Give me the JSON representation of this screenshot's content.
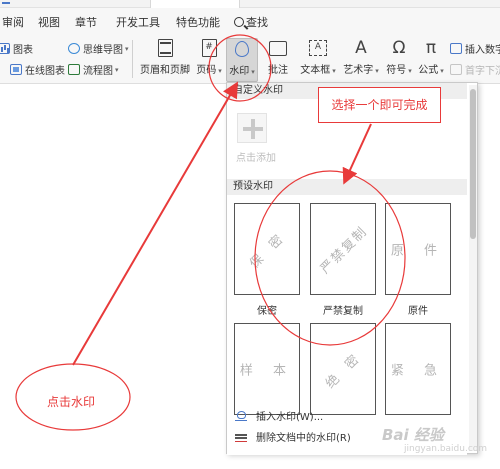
{
  "menu": {
    "items": [
      "审阅",
      "视图",
      "章节",
      "开发工具",
      "特色功能",
      "查找"
    ]
  },
  "ribbon": {
    "small": [
      {
        "label": "图表",
        "icon": "chart-icon"
      },
      {
        "label": "思维导图",
        "icon": "mindmap-icon"
      },
      {
        "label": "在线图表",
        "icon": "online-chart-icon"
      },
      {
        "label": "流程图",
        "icon": "flowchart-icon"
      }
    ],
    "big": [
      {
        "label": "页眉和页脚",
        "icon": "header-footer-icon"
      },
      {
        "label": "页码",
        "icon": "page-number-icon"
      },
      {
        "label": "水印",
        "icon": "watermark-icon"
      },
      {
        "label": "批注",
        "icon": "comment-icon"
      },
      {
        "label": "文本框",
        "icon": "textbox-icon"
      },
      {
        "label": "艺术字",
        "icon": "wordart-icon"
      },
      {
        "label": "符号",
        "icon": "symbol-icon"
      },
      {
        "label": "公式",
        "icon": "formula-icon"
      }
    ],
    "right": {
      "insert_number": "插入数字",
      "first_drop": "首字下沉"
    },
    "page_number_glyph": "#",
    "textbox_glyph": "A",
    "wordart_glyph": "A",
    "symbol_glyph": "Ω",
    "formula_glyph": "π"
  },
  "panel": {
    "custom_header": "自定义水印",
    "add_label": "点击添加",
    "preset_header": "预设水印",
    "presets": [
      {
        "label": "保密",
        "text": "保 密",
        "style": "diagonal"
      },
      {
        "label": "严禁复制",
        "text": "严禁复制",
        "style": "diagonal"
      },
      {
        "label": "原件",
        "text": "原 件",
        "style": "diagonal"
      },
      {
        "label": "",
        "text": "样 本",
        "style": "flat"
      },
      {
        "label": "",
        "text": "绝 密",
        "style": "diagonal"
      },
      {
        "label": "",
        "text": "紧 急",
        "style": "flat"
      }
    ],
    "footer": {
      "insert": "插入水印(W)...",
      "remove": "删除文档中的水印(R)"
    }
  },
  "annotations": {
    "callout": "选择一个即可完成",
    "click_hint": "点击水印",
    "color": "#e83a3a"
  },
  "watermark": {
    "logo": "Bai 经验",
    "url": "jingyan.baidu.com"
  }
}
